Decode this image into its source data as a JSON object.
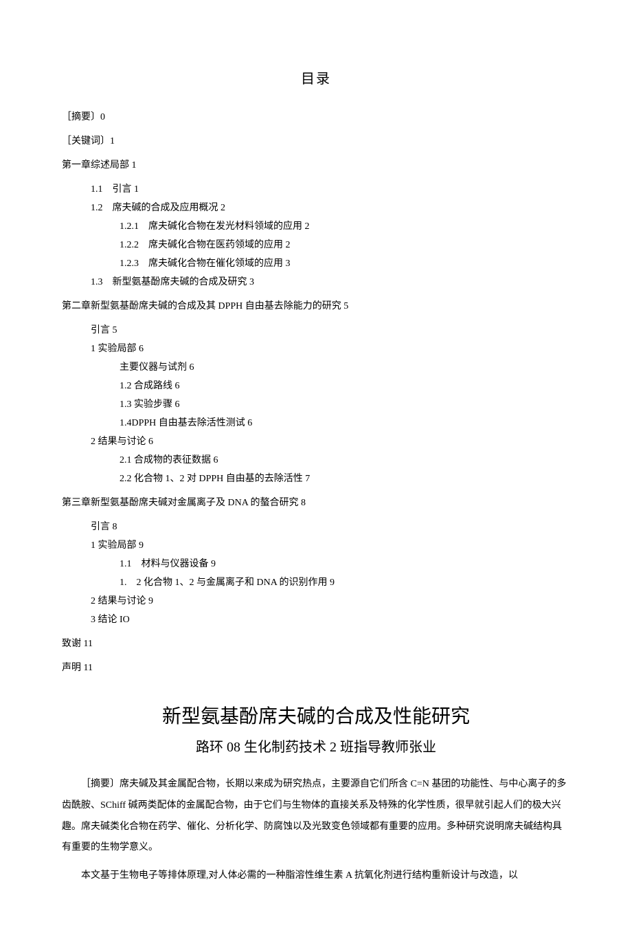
{
  "toc": {
    "title": "目录",
    "entries": [
      {
        "level": 0,
        "text": "［摘要〕0"
      },
      {
        "level": 0,
        "text": "［关键词〕1"
      },
      {
        "level": 0,
        "text": "第一章综述局部 1"
      },
      {
        "level": 1,
        "text": "1.1　引言 1"
      },
      {
        "level": 1,
        "text": "1.2　席夫碱的合成及应用概况 2"
      },
      {
        "level": 2,
        "text": "1.2.1　席夫碱化合物在发光材料领域的应用 2"
      },
      {
        "level": 2,
        "text": "1.2.2　席夫碱化合物在医药领域的应用 2"
      },
      {
        "level": 2,
        "text": "1.2.3　席夫碱化合物在催化领域的应用 3"
      },
      {
        "level": 1,
        "text": "1.3　新型氨基酚席夫碱的合成及研究 3"
      },
      {
        "level": 0,
        "text": "第二章新型氨基酚席夫碱的合成及其 DPPH 自由基去除能力的研究 5"
      },
      {
        "level": 1,
        "text": "引言 5"
      },
      {
        "level": 1,
        "text": "1 实验局部 6"
      },
      {
        "level": 2,
        "text": "主要仪器与试剂 6"
      },
      {
        "level": 2,
        "text": "1.2 合成路线 6"
      },
      {
        "level": 2,
        "text": "1.3 实验步骤 6"
      },
      {
        "level": 2,
        "text": "1.4DPPH 自由基去除活性测试 6"
      },
      {
        "level": 1,
        "text": "2 结果与讨论 6"
      },
      {
        "level": 2,
        "text": "2.1 合成物的表征数据 6"
      },
      {
        "level": 2,
        "text": "2.2 化合物 1、2 对 DPPH 自由基的去除活性 7"
      },
      {
        "level": 0,
        "text": "第三章新型氨基酚席夫碱对金属离子及 DNA 的螯合研究 8"
      },
      {
        "level": 1,
        "text": "引言 8"
      },
      {
        "level": 1,
        "text": "1 实验局部 9"
      },
      {
        "level": 2,
        "text": "1.1　材料与仪器设备 9"
      },
      {
        "level": 2,
        "text": "1.　2 化合物 1、2 与金属离子和 DNA 的识别作用 9"
      },
      {
        "level": 1,
        "text": "2 结果与讨论 9"
      },
      {
        "level": 1,
        "text": "3 结论 IO"
      },
      {
        "level": 0,
        "text": "致谢 11"
      },
      {
        "level": 0,
        "text": "声明 11"
      }
    ]
  },
  "article": {
    "title": "新型氨基酚席夫碱的合成及性能研究",
    "subtitle": "路环 08 生化制药技术 2 班指导教师张业",
    "abstract_p1": "［摘要〕席夫碱及其金属配合物，长期以来成为研究热点，主要源自它们所含 C=N 基团的功能性、与中心离子的多齿酰胺、SChiff 碱两类配体的金属配合物，由于它们与生物体的直接关系及特殊的化学性质，很早就引起人们的极大兴趣。席夫碱类化合物在药学、催化、分析化学、防腐蚀以及光致变色领域都有重要的应用。多种研究说明席夫碱结构具有重要的生物学意义。",
    "abstract_p2": "本文基于生物电子等排体原理,对人体必需的一种脂溶性维生素 A 抗氧化剂进行结构重新设计与改造，以"
  }
}
